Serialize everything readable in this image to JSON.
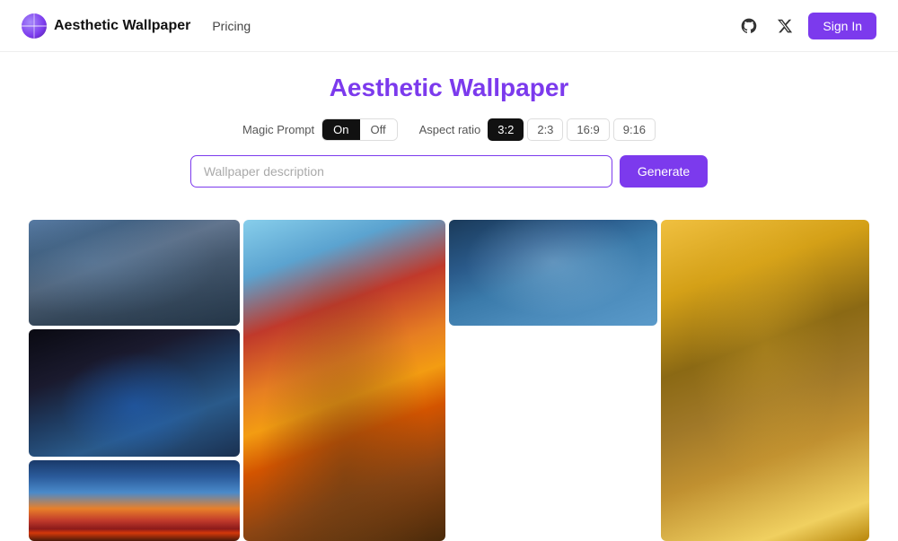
{
  "header": {
    "logo_alt": "Aesthetic Wallpaper Logo",
    "title": "Aesthetic Wallpaper",
    "nav": [
      {
        "label": "Pricing",
        "id": "pricing"
      }
    ],
    "sign_in": "Sign In",
    "github_icon": "github-icon",
    "twitter_icon": "twitter-icon"
  },
  "hero": {
    "title": "Aesthetic Wallpaper"
  },
  "controls": {
    "magic_prompt_label": "Magic Prompt",
    "toggle_on": "On",
    "toggle_off": "Off",
    "aspect_ratio_label": "Aspect ratio",
    "ratios": [
      "3:2",
      "2:3",
      "16:9",
      "9:16"
    ],
    "active_ratio": "3:2",
    "active_toggle": "On"
  },
  "search": {
    "placeholder": "Wallpaper description",
    "value": "",
    "generate_label": "Generate"
  },
  "gallery": {
    "images": [
      {
        "id": "img-1",
        "class": "img-destroyed-house",
        "alt": "Destroyed blue house in rubble"
      },
      {
        "id": "img-2",
        "class": "img-tulips",
        "alt": "Blue tulips in glass vase"
      },
      {
        "id": "img-3",
        "class": "img-sunset",
        "alt": "Sunset over red flower field"
      },
      {
        "id": "img-4",
        "class": "img-autumn-tree",
        "alt": "Autumn tree viewed from below"
      },
      {
        "id": "img-5",
        "class": "img-dandelion",
        "alt": "Dandelion seeds with water droplets"
      },
      {
        "id": "img-6",
        "class": "img-bird",
        "alt": "Brown bird on branch with yellow leaves"
      }
    ]
  },
  "colors": {
    "accent": "#7c3aed",
    "accent_dark": "#5b21b6",
    "text_dark": "#111111",
    "text_muted": "#555555"
  }
}
